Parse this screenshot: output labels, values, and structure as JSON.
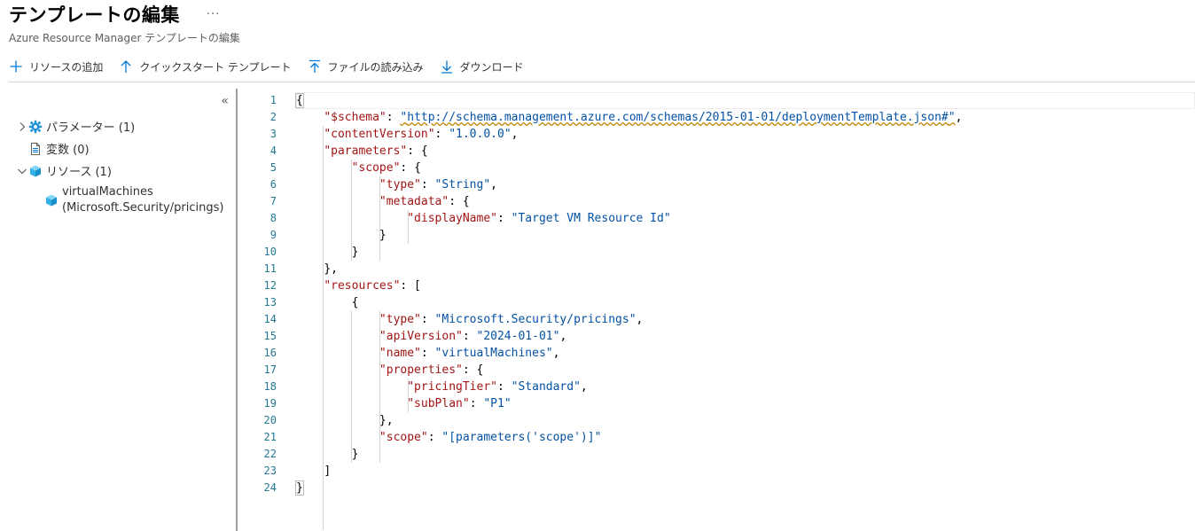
{
  "header": {
    "title": "テンプレートの編集",
    "more": "···",
    "subtitle": "Azure Resource Manager テンプレートの編集"
  },
  "toolbar": {
    "add_resource": "リソースの追加",
    "quickstart": "クイックスタート テンプレート",
    "load_file": "ファイルの読み込み",
    "download": "ダウンロード"
  },
  "sidebar": {
    "collapse": "«",
    "parameters": "パラメーター (1)",
    "variables": "変数 (0)",
    "resources": "リソース (1)",
    "child_line1": "virtualMachines",
    "child_line2": "(Microsoft.Security/pricings)"
  },
  "colors": {
    "key": "#a31515",
    "string": "#0451a5",
    "line_number": "#237893",
    "accent": "#0078d4"
  },
  "editor": {
    "line_numbers": [
      "1",
      "2",
      "3",
      "4",
      "5",
      "6",
      "7",
      "8",
      "9",
      "10",
      "11",
      "12",
      "13",
      "14",
      "15",
      "16",
      "17",
      "18",
      "19",
      "20",
      "21",
      "22",
      "23",
      "24"
    ],
    "schema_url": "http://schema.management.azure.com/schemas/2015-01-01/deploymentTemplate.json#",
    "content_version": "1.0.0.0",
    "param_name": "scope",
    "param_type": "String",
    "display_name": "Target VM Resource Id",
    "resource_type": "Microsoft.Security/pricings",
    "api_version": "2024-01-01",
    "resource_name": "virtualMachines",
    "pricing_tier": "Standard",
    "sub_plan": "P1",
    "scope_expr": "[parameters('scope')]"
  }
}
